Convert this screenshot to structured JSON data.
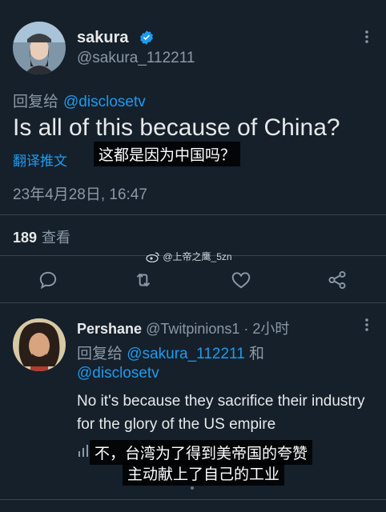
{
  "main_tweet": {
    "author_name": "sakura",
    "author_handle": "@sakura_112211",
    "replying_to_label": "回复给",
    "replying_to_handle": "@disclosetv",
    "text": "Is all of this because of China?",
    "translate_label": "翻译推文",
    "subtitle": "这都是因为中国吗？",
    "timestamp": "23年4月28日, 16:47",
    "views_count": "189",
    "views_label": "查看"
  },
  "watermark": "@上帝之鹰_5zn",
  "actions": {
    "reply_icon": "reply-icon",
    "retweet_icon": "retweet-icon",
    "like_icon": "heart-icon",
    "share_icon": "share-icon"
  },
  "reply_tweet": {
    "author_name": "Pershane",
    "author_handle": "@Twitpinions1",
    "separator": "·",
    "time": "2小时",
    "replying_to_label": "回复给",
    "replying_to_handle1": "@sakura_112211",
    "and_label": "和",
    "replying_to_handle2": "@disclosetv",
    "text": "No it's because they sacrifice their industry for the glory of the US empire",
    "subtitle_line1": "不，台湾为了得到美帝国的夸赞",
    "subtitle_line2": "主动献上了自己的工业"
  },
  "colors": {
    "background": "#15202b",
    "accent": "#1d9bf0",
    "muted": "#8b98a5",
    "text": "#e7e9ea"
  }
}
